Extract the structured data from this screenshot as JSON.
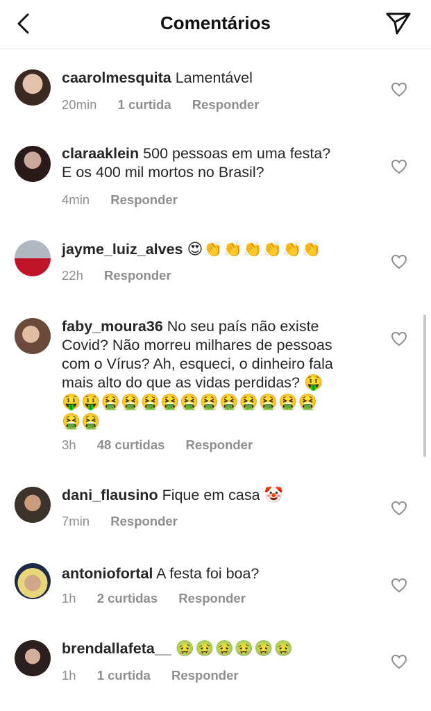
{
  "header": {
    "title": "Comentários"
  },
  "comments": [
    {
      "username": "caarolmesquita",
      "text": "Lamentável",
      "text2": "",
      "emojis": "",
      "emojis2": "",
      "time": "20min",
      "likes": "1 curtida",
      "reply": "Responder"
    },
    {
      "username": "claraaklein",
      "text": "500 pessoas em uma festa?",
      "text2": "E os 400 mil mortos no Brasil?",
      "emojis": "",
      "emojis2": "",
      "time": "4min",
      "likes": "",
      "reply": "Responder"
    },
    {
      "username": "jayme_luiz_alves",
      "text": "",
      "text2": "",
      "emojis": "😍👏👏👏👏👏👏",
      "emojis2": "",
      "time": "22h",
      "likes": "",
      "reply": "Responder"
    },
    {
      "username": "faby_moura36",
      "text": "No seu país não existe",
      "text2": "Covid? Não morreu milhares de pessoas",
      "text3": "com o Vírus? Ah, esqueci, o dinheiro fala",
      "text4": "mais alto do que as vidas perdidas?",
      "emojis": "🤑",
      "emojis2": "🤑🤑🤮🤮🤮🤮🤮🤮🤮🤮🤮🤮🤮",
      "emojis3": "🤮🤮",
      "time": "3h",
      "likes": "48 curtidas",
      "reply": "Responder"
    },
    {
      "username": "dani_flausino",
      "text": "Fique em casa",
      "text2": "",
      "emojis": "🤡",
      "emojis2": "",
      "time": "7min",
      "likes": "",
      "reply": "Responder"
    },
    {
      "username": "antoniofortal",
      "text": "A festa foi boa?",
      "text2": "",
      "emojis": "",
      "emojis2": "",
      "time": "1h",
      "likes": "2 curtidas",
      "reply": "Responder"
    },
    {
      "username": "brendallafeta__",
      "text": "",
      "text2": "",
      "emojis": "🤢🤢🤢🤢🤢🤢",
      "emojis2": "",
      "time": "1h",
      "likes": "1 curtida",
      "reply": "Responder"
    }
  ],
  "colors": {
    "text": "#262626",
    "meta": "#8e8e8e",
    "divider": "#e6e6e6"
  }
}
